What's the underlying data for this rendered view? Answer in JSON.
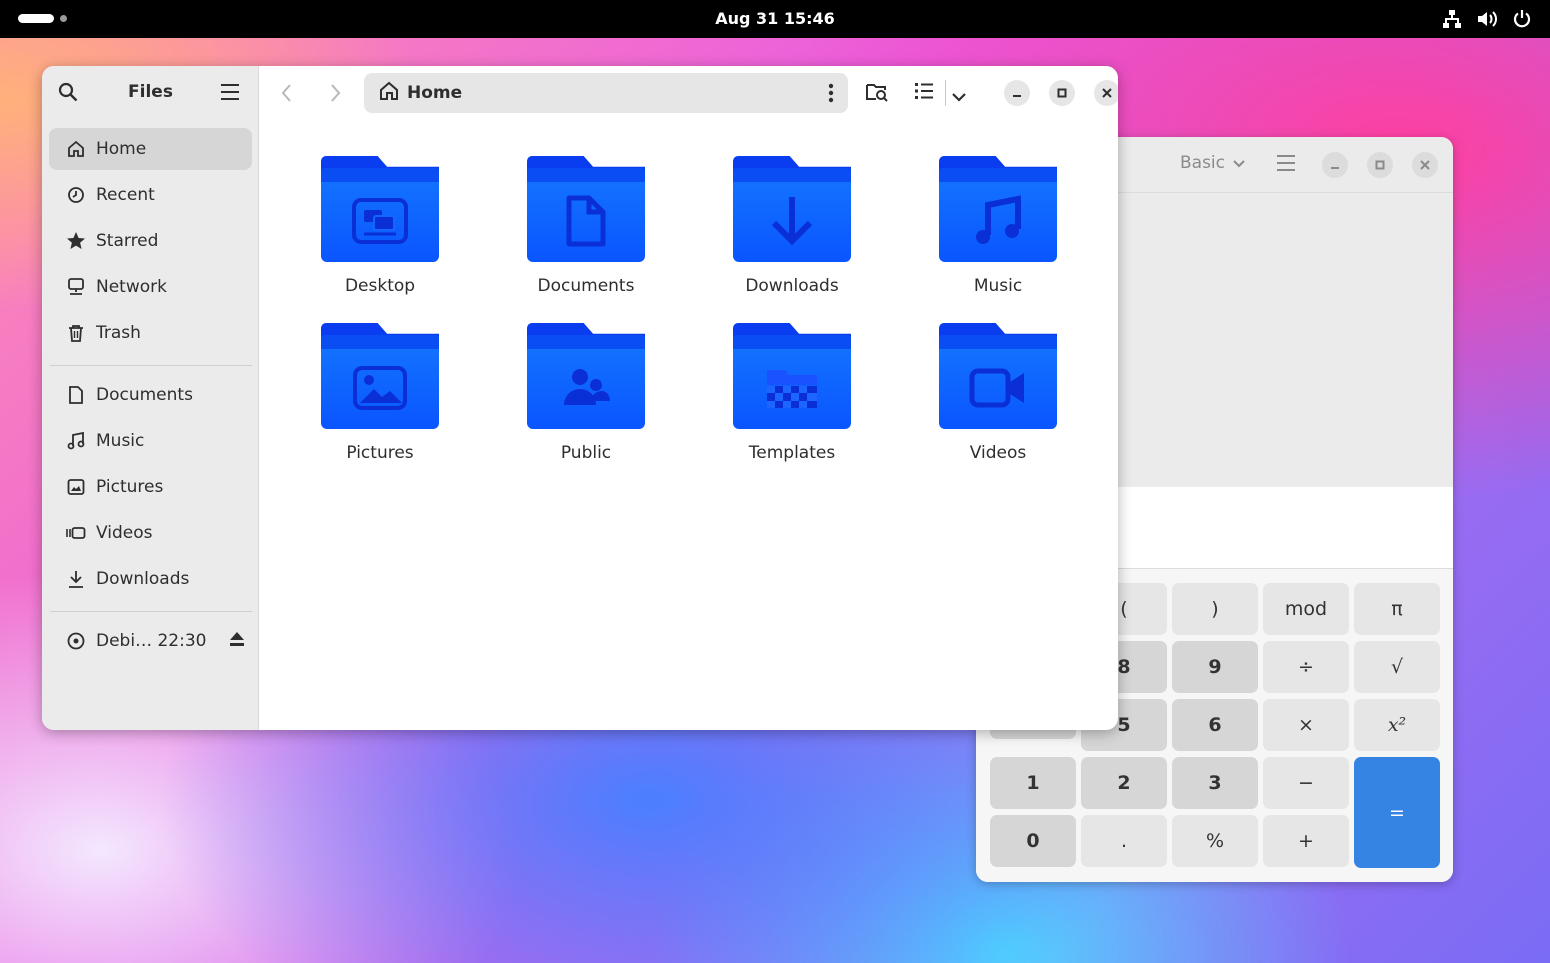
{
  "topbar": {
    "clock": "Aug 31  15:46",
    "icons": [
      "network-icon",
      "volume-icon",
      "power-icon"
    ]
  },
  "files": {
    "title": "Files",
    "path": "Home",
    "sidebar": {
      "places": [
        {
          "label": "Home",
          "icon": "home-icon",
          "active": true
        },
        {
          "label": "Recent",
          "icon": "clock-icon"
        },
        {
          "label": "Starred",
          "icon": "star-icon"
        },
        {
          "label": "Network",
          "icon": "network-icon"
        },
        {
          "label": "Trash",
          "icon": "trash-icon"
        }
      ],
      "bookmarks": [
        {
          "label": "Documents",
          "icon": "document-icon"
        },
        {
          "label": "Music",
          "icon": "music-icon"
        },
        {
          "label": "Pictures",
          "icon": "image-icon"
        },
        {
          "label": "Videos",
          "icon": "video-icon"
        },
        {
          "label": "Downloads",
          "icon": "download-icon"
        }
      ],
      "devices": [
        {
          "label": "Debi… 22:30",
          "icon": "disc-icon"
        }
      ]
    },
    "folders": [
      {
        "label": "Desktop",
        "emblem": "desktop"
      },
      {
        "label": "Documents",
        "emblem": "document"
      },
      {
        "label": "Downloads",
        "emblem": "download"
      },
      {
        "label": "Music",
        "emblem": "music"
      },
      {
        "label": "Pictures",
        "emblem": "picture"
      },
      {
        "label": "Public",
        "emblem": "people"
      },
      {
        "label": "Templates",
        "emblem": "template"
      },
      {
        "label": "Videos",
        "emblem": "video"
      }
    ],
    "accent": "#0a55ff"
  },
  "calculator": {
    "mode": "Basic",
    "keys": [
      {
        "label": "(",
        "kind": "op"
      },
      {
        "label": ")",
        "kind": "op"
      },
      {
        "label": "mod",
        "kind": "op"
      },
      {
        "label": "π",
        "kind": "op"
      },
      {
        "label": "8",
        "kind": "num"
      },
      {
        "label": "9",
        "kind": "num"
      },
      {
        "label": "÷",
        "kind": "op"
      },
      {
        "label": "√",
        "kind": "op"
      },
      {
        "label": "5",
        "kind": "num"
      },
      {
        "label": "6",
        "kind": "num"
      },
      {
        "label": "×",
        "kind": "op"
      },
      {
        "label": "x²",
        "kind": "op"
      },
      {
        "label": "1",
        "kind": "num"
      },
      {
        "label": "2",
        "kind": "num"
      },
      {
        "label": "3",
        "kind": "num"
      },
      {
        "label": "−",
        "kind": "op"
      },
      {
        "label": "0",
        "kind": "num"
      },
      {
        "label": ".",
        "kind": "op"
      },
      {
        "label": "%",
        "kind": "op"
      },
      {
        "label": "+",
        "kind": "op"
      },
      {
        "label": "=",
        "kind": "eq"
      }
    ],
    "accent": "#3584e4"
  }
}
